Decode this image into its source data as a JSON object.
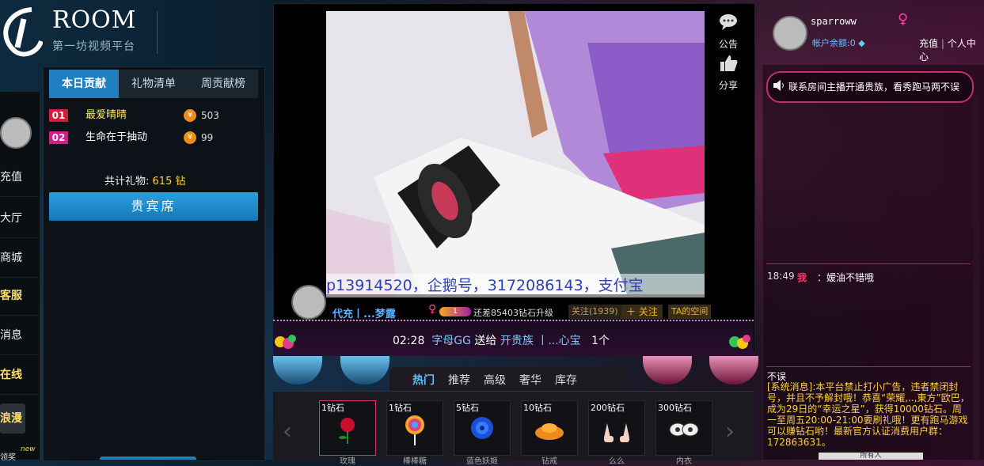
{
  "brand": {
    "logo_text": "ROOM",
    "subtitle": "第一坊视频平台"
  },
  "left_nav": {
    "items": [
      "充值",
      "大厅",
      "商城",
      "客服",
      "消息",
      "在线"
    ],
    "romance_label": "浪漫",
    "new_badge": "new",
    "bottom_label": "领奖"
  },
  "contribution": {
    "tabs": [
      "本日贡献",
      "礼物清单",
      "周贡献榜"
    ],
    "rows": [
      {
        "rank": "01",
        "name": "最爱晴晴",
        "value": "503",
        "color": "#d81b3a",
        "name_color": "#ffe066"
      },
      {
        "rank": "02",
        "name": "生命在于抽动",
        "value": "99",
        "color": "#d81b8a",
        "name_color": "#ffffff"
      }
    ],
    "coin_symbol": "¥",
    "total_label": "共计礼物:",
    "total_value": "615 钻",
    "vip_button": "贵宾席"
  },
  "video": {
    "caption": "p13914520，企鹅号，3172086143，支付宝",
    "notice_label": "公告",
    "share_label": "分享"
  },
  "host": {
    "name": "代充丨...梦露",
    "gender_symbol": "♀",
    "level": "1",
    "upgrade_text": "还差85403钻石升级",
    "follow_count": "关注(1939)",
    "follow_button": "＋ 关注",
    "space_button": "TA的空间"
  },
  "gift_broadcast": {
    "time": "02:28",
    "sender": "字母GG",
    "action": "送给",
    "gift": "开贵族",
    "receiver": "丨...心宝",
    "count": "1个"
  },
  "gift_tabs": [
    "热门",
    "推荐",
    "高级",
    "奢华",
    "库存"
  ],
  "gifts": [
    {
      "price": "1钻石",
      "name": "玫瑰",
      "icon": "rose-icon"
    },
    {
      "price": "1钻石",
      "name": "棒棒糖",
      "icon": "lollipop-icon"
    },
    {
      "price": "5钻石",
      "name": "蓝色妖姬",
      "icon": "blue-rose-icon"
    },
    {
      "price": "10钻石",
      "name": "钻戒",
      "icon": "gold-ingot-icon"
    },
    {
      "price": "200钻石",
      "name": "么么",
      "icon": "hands-icon"
    },
    {
      "price": "300钻石",
      "name": "内衣",
      "icon": "lingerie-icon"
    }
  ],
  "user": {
    "username": "sparroww",
    "gender_symbol": "♀",
    "balance_label": "帐户余额:0",
    "recharge": "充值",
    "separator": "|",
    "center": "个人中心"
  },
  "chat": {
    "notice": "联系房间主播开通贵族，看秀跑马两不误",
    "messages": [
      {
        "time": "18:49",
        "sender": "我",
        "text": "：嫒油不错哦"
      }
    ],
    "system_head": "不误",
    "system_msg": "[系统消息]:本平台禁止打小广告，违者禁闭封号，并且不予解封哦！恭喜“荣耀,..,東方”欧巴，成为29日的“幸运之星”，获得10000钻石。周一至周五20:00-21:00要刷礼哦！更有跑马游戏可以赚钻石哟！最新官方认证消费用户群：172863631。",
    "recipient": "所有人"
  }
}
